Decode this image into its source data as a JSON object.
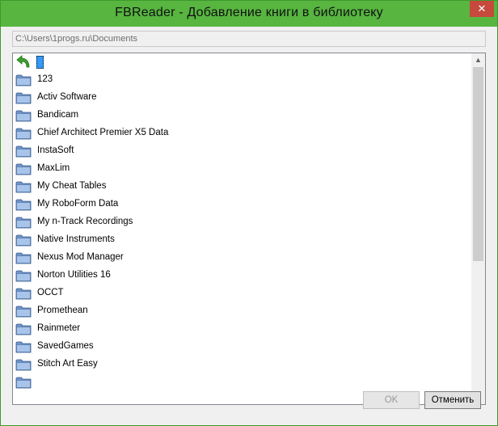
{
  "window": {
    "title": "FBReader - Добавление книги в библиотеку",
    "close_glyph": "✕"
  },
  "path": "C:\\Users\\1progs.ru\\Documents",
  "list": {
    "items": [
      {
        "label": "123"
      },
      {
        "label": "Activ Software"
      },
      {
        "label": "Bandicam"
      },
      {
        "label": "Chief Architect Premier X5 Data"
      },
      {
        "label": "InstaSoft"
      },
      {
        "label": "MaxLim"
      },
      {
        "label": "My Cheat Tables"
      },
      {
        "label": "My RoboForm Data"
      },
      {
        "label": "My n-Track Recordings"
      },
      {
        "label": "Native Instruments"
      },
      {
        "label": "Nexus Mod Manager"
      },
      {
        "label": "Norton Utilities 16"
      },
      {
        "label": "OCCT"
      },
      {
        "label": "Promethean"
      },
      {
        "label": "Rainmeter"
      },
      {
        "label": "SavedGames"
      },
      {
        "label": "Stitch Art Easy"
      },
      {
        "label": ""
      }
    ]
  },
  "scrollbar": {
    "up_glyph": "▲",
    "down_glyph": "▼"
  },
  "buttons": {
    "ok": "OK",
    "cancel": "Отменить"
  },
  "colors": {
    "titlebar": "#57b540",
    "selection": "#3399ff",
    "close": "#c7493d"
  }
}
